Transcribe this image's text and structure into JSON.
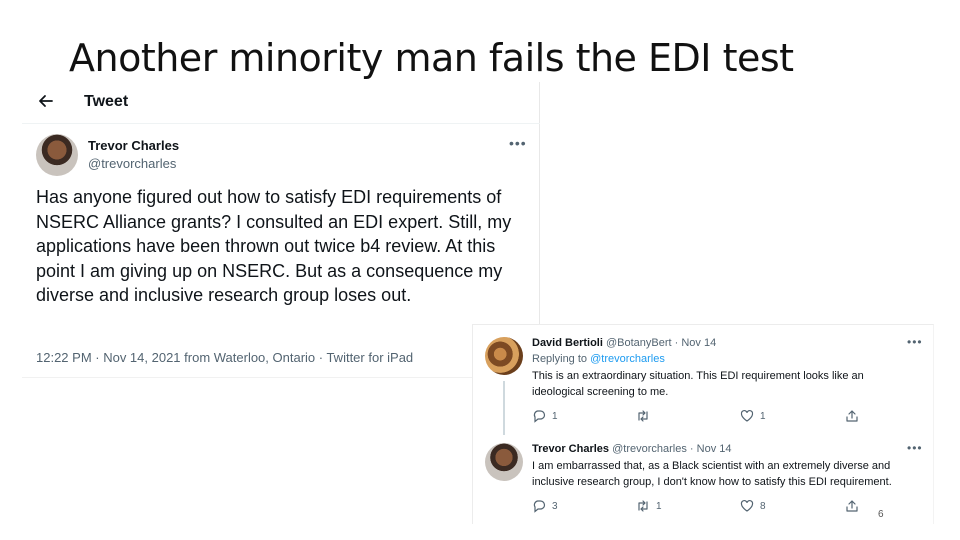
{
  "slide": {
    "title": "Another minority man fails the EDI test",
    "page_number": "6"
  },
  "main_tweet": {
    "header_title": "Tweet",
    "author_name": "Trevor Charles",
    "author_handle": "@trevorcharles",
    "more": "•••",
    "text": "Has anyone figured out how to satisfy EDI requirements of NSERC Alliance grants? I consulted an EDI expert. Still, my applications have been thrown out twice b4 review. At this point I am giving up on NSERC. But as a consequence my diverse and inclusive research group loses out.",
    "meta": "12:22 PM · Nov 14, 2021 from Waterloo, Ontario · Twitter for iPad"
  },
  "replies": [
    {
      "name": "David Bertioli",
      "handle_date": "@BotanyBert · Nov 14",
      "replying_label": "Replying to",
      "replying_to": "@trevorcharles",
      "text": "This is an extraordinary situation. This EDI requirement looks like an ideological screening to me.",
      "more": "•••",
      "reply_count": "1",
      "retweet_count": "",
      "like_count": "1"
    },
    {
      "name": "Trevor Charles",
      "handle_date": "@trevorcharles · Nov 14",
      "text": "I am embarrassed that, as a Black scientist with an extremely diverse and inclusive research group, I don't know how to satisfy this EDI requirement.",
      "more": "•••",
      "reply_count": "3",
      "retweet_count": "1",
      "like_count": "8"
    }
  ],
  "icons": {
    "back": "arrow-left-icon",
    "more": "more-icon",
    "reply": "reply-icon",
    "retweet": "retweet-icon",
    "like": "heart-icon",
    "share": "share-icon"
  },
  "colors": {
    "text": "#0f1419",
    "secondary": "#536471",
    "link": "#1d9bf0"
  }
}
